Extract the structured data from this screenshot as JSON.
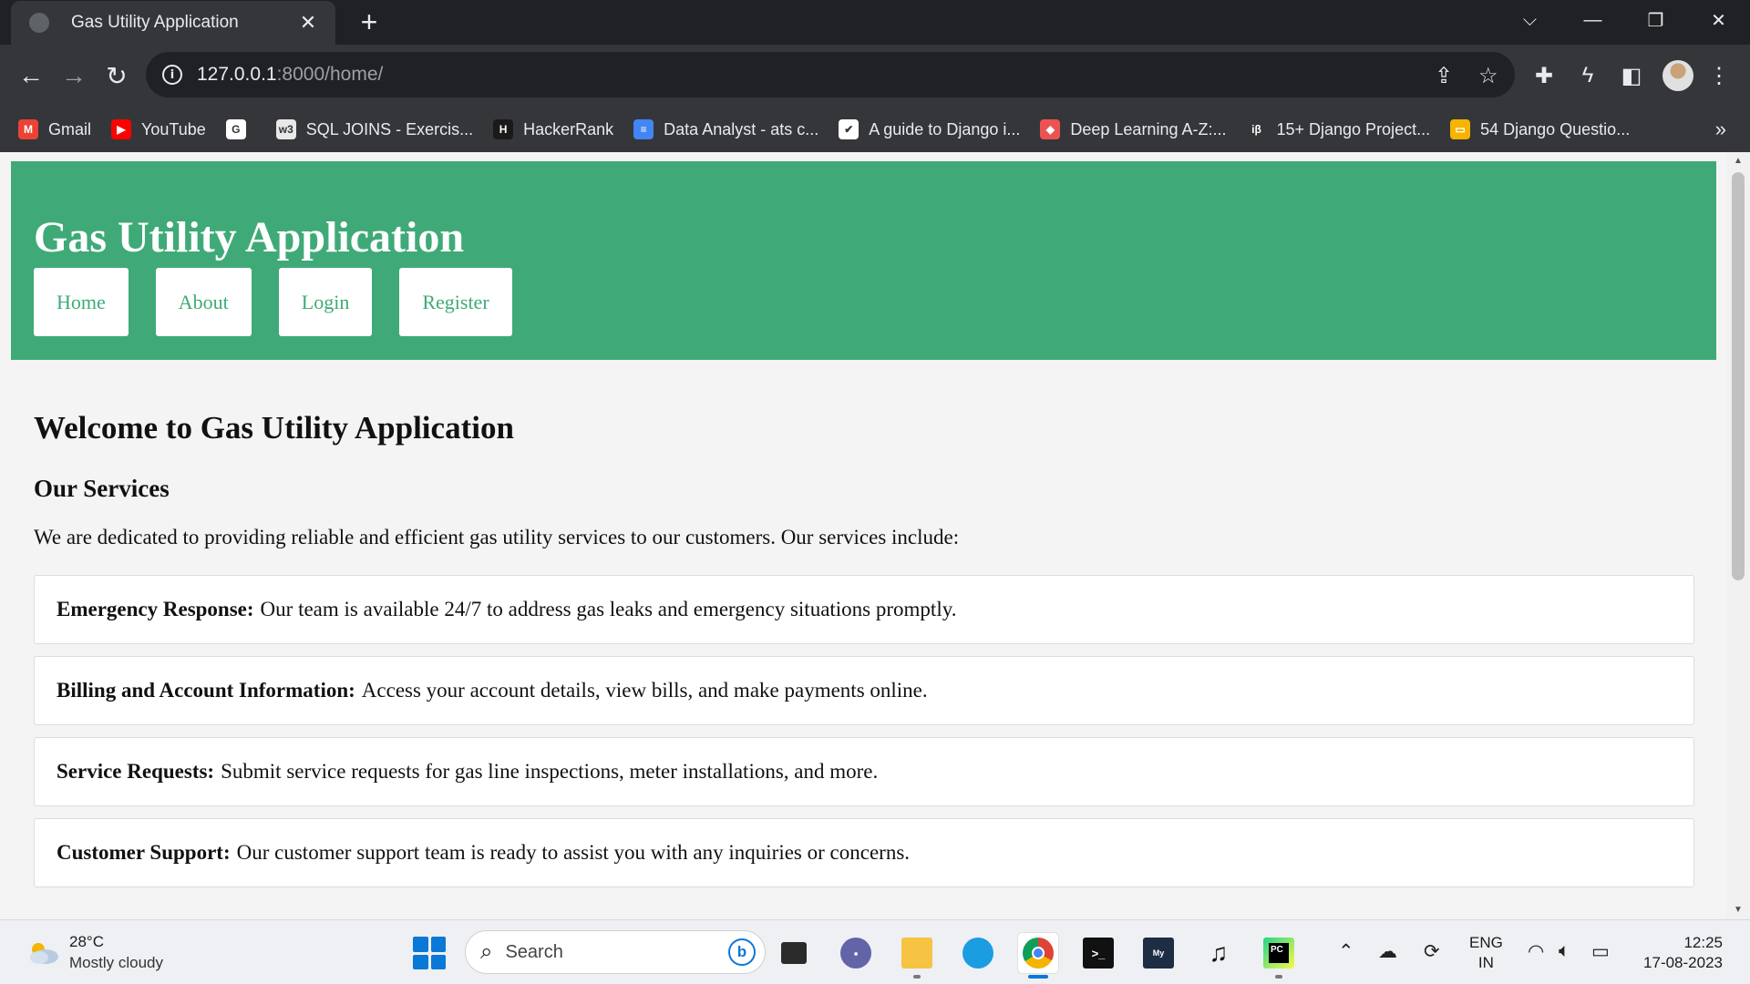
{
  "browser": {
    "tab_title": "Gas Utility Application",
    "tab_close": "✕",
    "new_tab": "+",
    "url_host": "127.0.0.1",
    "url_rest": ":8000/home/",
    "bookmarks": [
      {
        "label": "Gmail",
        "icon": "gmail-icon",
        "color": "#ea4335",
        "glyph": "M"
      },
      {
        "label": "YouTube",
        "icon": "youtube-icon",
        "color": "#ff0000",
        "glyph": "▶"
      },
      {
        "label": "",
        "icon": "google-icon",
        "color": "#ffffff",
        "glyph": "G"
      },
      {
        "label": "SQL JOINS - Exercis...",
        "icon": "w3schools-icon",
        "color": "#e8e8e8",
        "glyph": "w3"
      },
      {
        "label": "HackerRank",
        "icon": "hackerrank-icon",
        "color": "#1a1a1a",
        "glyph": "H"
      },
      {
        "label": "Data Analyst - ats c...",
        "icon": "google-docs-icon",
        "color": "#4285f4",
        "glyph": "≡"
      },
      {
        "label": "A guide to Django i...",
        "icon": "bookmark-site-icon",
        "color": "#ffffff",
        "glyph": "✔"
      },
      {
        "label": "Deep Learning A-Z:...",
        "icon": "udemy-icon",
        "color": "#ec5252",
        "glyph": "◆"
      },
      {
        "label": "15+ Django Project...",
        "icon": "interviewbit-icon",
        "color": "#35363a",
        "glyph": "iβ"
      },
      {
        "label": "54 Django Questio...",
        "icon": "slides-icon",
        "color": "#f4b400",
        "glyph": "▭"
      }
    ],
    "bookmarks_more": "»"
  },
  "site": {
    "title": "Gas Utility Application",
    "nav": [
      "Home",
      "About",
      "Login",
      "Register"
    ],
    "welcome": "Welcome to Gas Utility Application",
    "services_heading": "Our Services",
    "intro": "We are dedicated to providing reliable and efficient gas utility services to our customers. Our services include:",
    "services": [
      {
        "title": "Emergency Response:",
        "text": "Our team is available 24/7 to address gas leaks and emergency situations promptly."
      },
      {
        "title": "Billing and Account Information:",
        "text": "Access your account details, view bills, and make payments online."
      },
      {
        "title": "Service Requests:",
        "text": "Submit service requests for gas line inspections, meter installations, and more."
      },
      {
        "title": "Customer Support:",
        "text": "Our customer support team is ready to assist you with any inquiries or concerns."
      }
    ],
    "colors": {
      "header": "#3faa78",
      "button_text": "#3faa78"
    }
  },
  "taskbar": {
    "weather_temp": "28°C",
    "weather_desc": "Mostly cloudy",
    "search_placeholder": "Search",
    "bing_glyph": "b",
    "lang_line1": "ENG",
    "lang_line2": "IN",
    "time": "12:25",
    "date": "17-08-2023"
  }
}
